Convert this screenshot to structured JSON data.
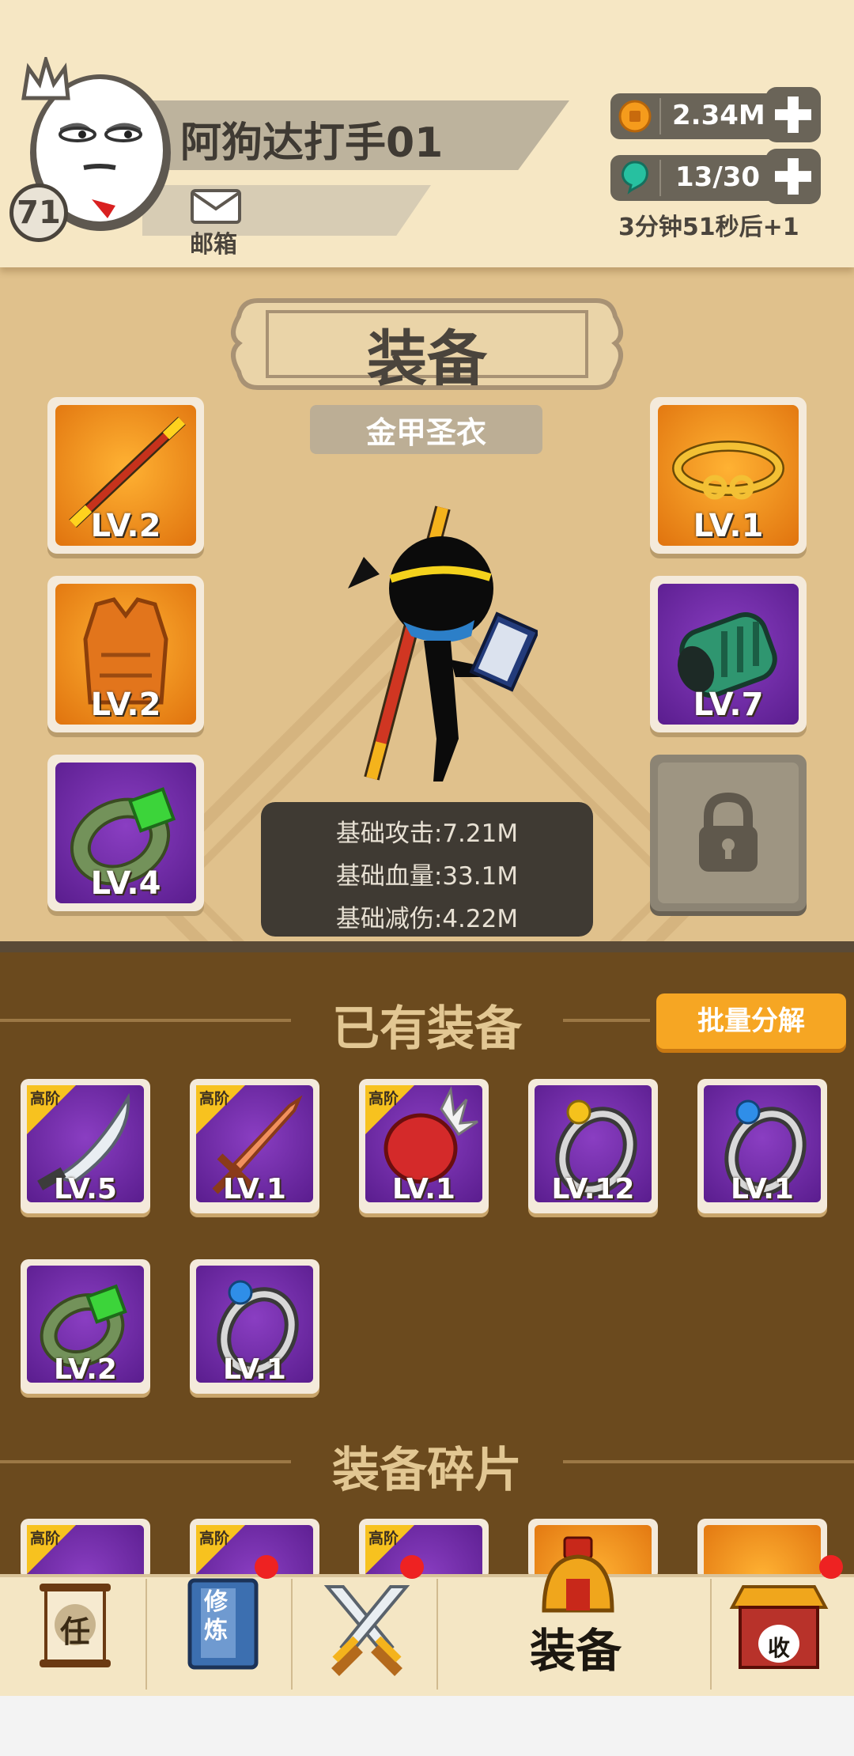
{
  "player": {
    "name": "阿狗达打手01",
    "level": "71",
    "mail_label": "邮箱"
  },
  "resources": {
    "coins": "2.34M",
    "energy": "13/30",
    "timer": "3分钟51秒后+1"
  },
  "equipment": {
    "title": "装备",
    "set_name": "金甲圣衣",
    "left_slots": [
      {
        "name": "staff",
        "level": "LV.2",
        "rarity": "orange"
      },
      {
        "name": "vest",
        "level": "LV.2",
        "rarity": "orange"
      },
      {
        "name": "bracelet",
        "level": "LV.4",
        "rarity": "purple"
      }
    ],
    "right_slots": [
      {
        "name": "golden-circlet",
        "level": "LV.1",
        "rarity": "orange"
      },
      {
        "name": "gauntlet",
        "level": "LV.7",
        "rarity": "purple"
      },
      {
        "name": "locked",
        "level": "",
        "rarity": "locked"
      }
    ],
    "stats": {
      "attack": "基础攻击:7.21M",
      "hp": "基础血量:33.1M",
      "defense": "基础减伤:4.22M"
    }
  },
  "inventory": {
    "title": "已有装备",
    "batch_button": "批量分解",
    "tier_label": "高阶",
    "items": [
      {
        "name": "sabre",
        "level": "LV.5",
        "high_tier": true
      },
      {
        "name": "sword",
        "level": "LV.1",
        "high_tier": true
      },
      {
        "name": "spiked-glove",
        "level": "LV.1",
        "high_tier": true
      },
      {
        "name": "gold-ring",
        "level": "LV.12",
        "high_tier": false
      },
      {
        "name": "blue-ring",
        "level": "LV.1",
        "high_tier": false
      },
      {
        "name": "green-bracelet",
        "level": "LV.2",
        "high_tier": false
      },
      {
        "name": "blue-ring",
        "level": "LV.1",
        "high_tier": false
      }
    ]
  },
  "fragments": {
    "title": "装备碎片",
    "tier_label": "高阶"
  },
  "nav": {
    "tasks_glyph": "任",
    "cultivate_glyph": "修炼",
    "equipment_label": "装备",
    "shop_glyph": "收"
  },
  "colors": {
    "panel_bg": "#e0c18c",
    "inventory_bg": "#6b4a1e",
    "orange_slot": "#ff9a1a",
    "purple_slot": "#6e2aa6",
    "accent_button": "#f6a623",
    "notification_dot": "#ee2222"
  }
}
